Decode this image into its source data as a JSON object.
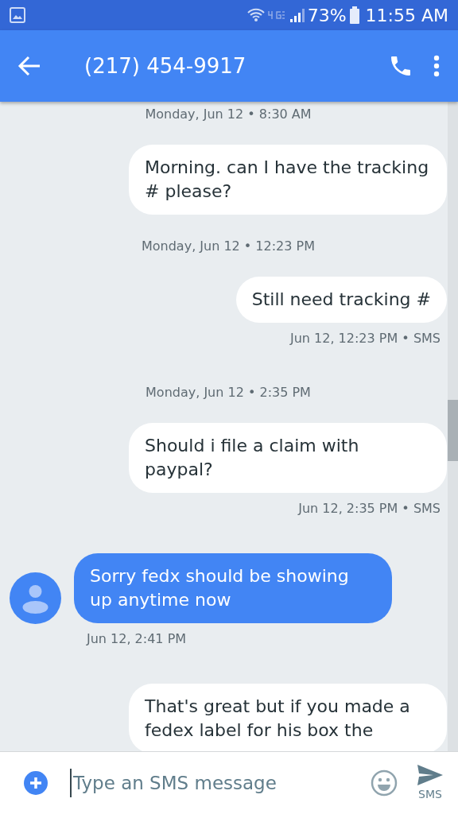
{
  "status_bar": {
    "battery": "73%",
    "time": "11:55 AM"
  },
  "app_bar": {
    "title": "(217) 454-9917"
  },
  "messages": [
    {
      "kind": "date",
      "text": "Monday, Jun 12 • 8:30 AM"
    },
    {
      "kind": "outgoing",
      "text": "Morning. can I have the tracking # please?"
    },
    {
      "kind": "date",
      "text": "Monday, Jun 12 • 12:23 PM"
    },
    {
      "kind": "outgoing",
      "text": "Still need tracking #",
      "meta": "Jun 12, 12:23 PM • SMS"
    },
    {
      "kind": "date",
      "text": "Monday, Jun 12 • 2:35 PM"
    },
    {
      "kind": "outgoing",
      "text": "Should i file a claim with paypal?",
      "meta": "Jun 12, 2:35 PM • SMS"
    },
    {
      "kind": "incoming",
      "text": "Sorry fedx should be showing up anytime now",
      "meta": "Jun 12, 2:41 PM"
    },
    {
      "kind": "outgoing",
      "text": "That's great but if you made a fedex label for his box the"
    }
  ],
  "composer": {
    "placeholder": "Type an SMS message",
    "send_label": "SMS"
  }
}
